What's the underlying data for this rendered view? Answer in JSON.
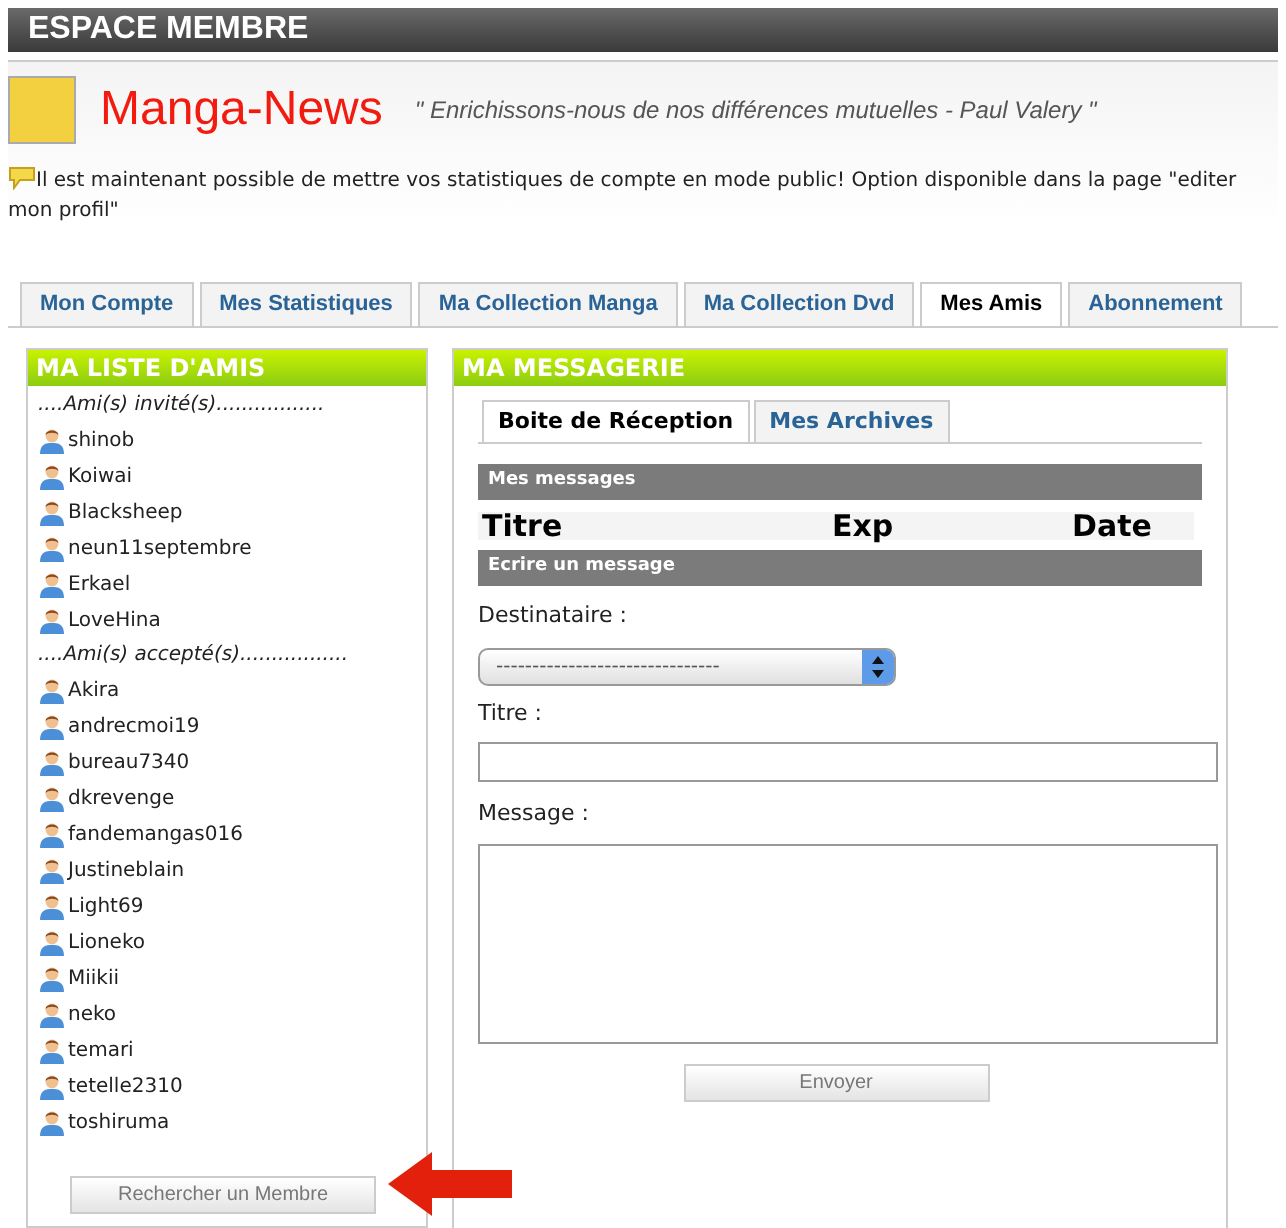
{
  "header": {
    "title": "ESPACE MEMBRE"
  },
  "site": {
    "name": "Manga-News",
    "quote": "\" Enrichissons-nous de nos différences mutuelles - Paul Valery \""
  },
  "notice": "Il est maintenant possible de mettre vos statistiques de compte en mode public! Option disponible dans la page \"editer mon profil\"",
  "tabs": [
    {
      "label": "Mon Compte",
      "selected": false
    },
    {
      "label": "Mes Statistiques",
      "selected": false
    },
    {
      "label": "Ma Collection Manga",
      "selected": false
    },
    {
      "label": "Ma Collection Dvd",
      "selected": false
    },
    {
      "label": "Mes Amis",
      "selected": true
    },
    {
      "label": "Abonnement",
      "selected": false
    }
  ],
  "friends_panel": {
    "title": "MA LISTE D'AMIS",
    "sections": [
      {
        "heading": "....Ami(s) invité(s).................",
        "members": [
          "shinob",
          "Koiwai",
          "Blacksheep",
          "neun11septembre",
          "Erkael",
          "LoveHina"
        ]
      },
      {
        "heading": "....Ami(s) accepté(s).................",
        "members": [
          "Akira",
          "andrecmoi19",
          "bureau7340",
          "dkrevenge",
          "fandemangas016",
          "Justineblain",
          "Light69",
          "Lioneko",
          "Miikii",
          "neko",
          "temari",
          "tetelle2310",
          "toshiruma"
        ]
      }
    ],
    "search_button": "Rechercher un Membre"
  },
  "messaging_panel": {
    "title": "MA MESSAGERIE",
    "tabs": [
      {
        "label": "Boite de Réception",
        "selected": true
      },
      {
        "label": "Mes Archives",
        "selected": false
      }
    ],
    "inbox_heading": "Mes messages",
    "columns": [
      "Titre",
      "Exp",
      "Date"
    ],
    "compose_heading": "Ecrire un message",
    "recipient_label": "Destinataire :",
    "recipient_value": "-------------------------------",
    "title_label": "Titre :",
    "message_label": "Message :",
    "send_button": "Envoyer"
  }
}
